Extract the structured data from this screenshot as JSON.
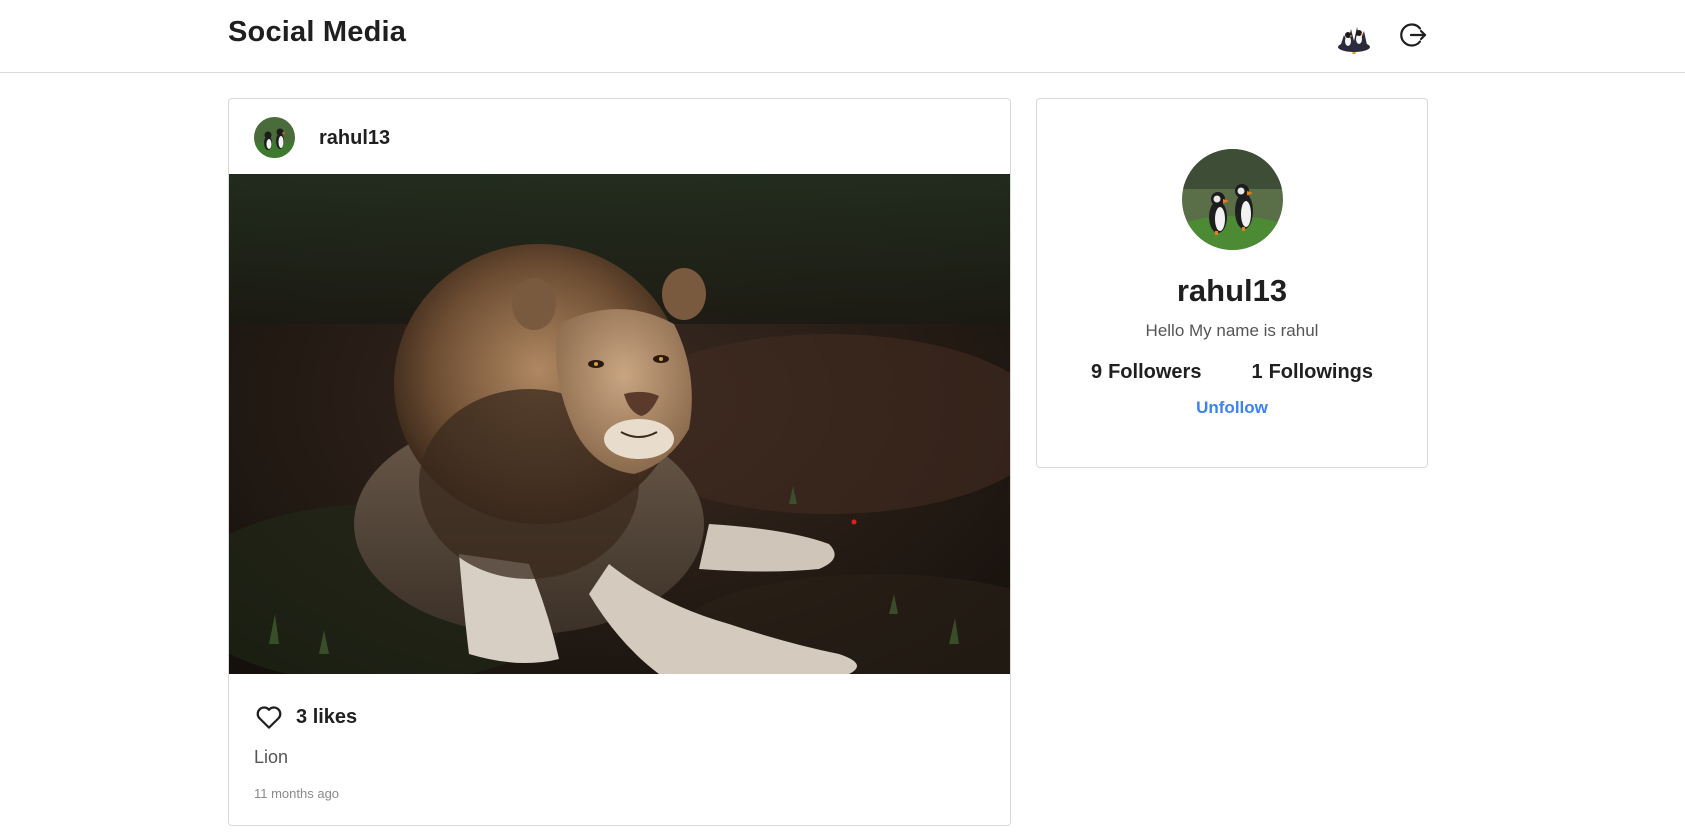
{
  "header": {
    "brand": "Social Media",
    "avatar_icon": "puffin-avatar-icon",
    "logout_icon": "logout-icon"
  },
  "post": {
    "username": "rahul13",
    "image_subject": "lion-photo",
    "likes_count": "3",
    "likes_label": "likes",
    "caption": "Lion",
    "timestamp": "11 months ago",
    "liked": false
  },
  "profile": {
    "username": "rahul13",
    "bio": "Hello My name is rahul",
    "followers_count": "9",
    "followers_label": "Followers",
    "followings_count": "1",
    "followings_label": "Followings",
    "follow_action": "Unfollow"
  },
  "colors": {
    "accent": "#3b82f6",
    "text": "#1f1f1f",
    "muted": "#555555",
    "border": "#d9d9d9"
  }
}
